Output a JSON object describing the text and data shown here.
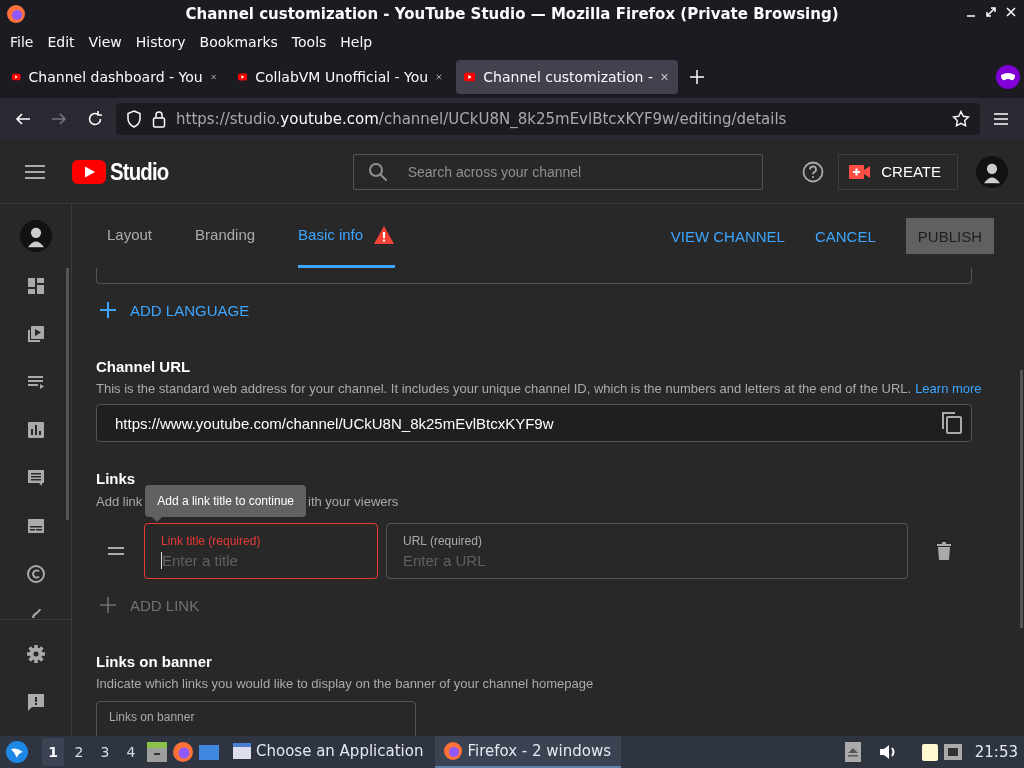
{
  "window": {
    "title": "Channel customization - YouTube Studio — Mozilla Firefox (Private Browsing)"
  },
  "menu": [
    "File",
    "Edit",
    "View",
    "History",
    "Bookmarks",
    "Tools",
    "Help"
  ],
  "browser_tabs": [
    {
      "label": "Channel dashboard - You",
      "selected": false
    },
    {
      "label": "CollabVM Unofficial - You",
      "selected": false
    },
    {
      "label": "Channel customization -",
      "selected": true
    }
  ],
  "address": {
    "prefix": "https://studio.",
    "domain": "youtube.com",
    "path": "/channel/UCkU8N_8k25mEvlBtcxKYF9w/editing/details"
  },
  "studio": {
    "logo": "Studio",
    "search_placeholder": "Search across your channel",
    "create": "CREATE"
  },
  "page_tabs": [
    {
      "label": "Layout",
      "selected": false,
      "warning": false
    },
    {
      "label": "Branding",
      "selected": false,
      "warning": false
    },
    {
      "label": "Basic info",
      "selected": true,
      "warning": true
    }
  ],
  "actions": [
    {
      "label": "VIEW CHANNEL",
      "disabled": false
    },
    {
      "label": "CANCEL",
      "disabled": false
    },
    {
      "label": "PUBLISH",
      "disabled": true
    }
  ],
  "add_language": "ADD LANGUAGE",
  "channel_url": {
    "heading": "Channel URL",
    "description": "This is the standard web address for your channel. It includes your unique channel ID, which is the numbers and letters at the end of the URL.",
    "link": "Learn more",
    "value": "https://www.youtube.com/channel/UCkU8N_8k25mEvlBtcxKYF9w"
  },
  "links": {
    "heading": "Links",
    "description_start": "Add link",
    "description_end": "ith your viewers",
    "tooltip": "Add a link title to continue",
    "fields": [
      {
        "label": "Link title (required)",
        "placeholder": "Enter a title",
        "error": true
      },
      {
        "label": "URL (required)",
        "placeholder": "Enter a URL",
        "error": false
      }
    ],
    "add_link": "ADD LINK"
  },
  "links_on_banner": {
    "heading": "Links on banner",
    "description": "Indicate which links you would like to display on the banner of your channel homepage",
    "select_label": "Links on banner"
  },
  "taskbar": {
    "workspaces": [
      {
        "label": "1",
        "selected": true
      },
      {
        "label": "2",
        "selected": false
      },
      {
        "label": "3",
        "selected": false
      },
      {
        "label": "4",
        "selected": false
      }
    ],
    "windows": [
      {
        "label": "Choose an Application",
        "selected": false
      },
      {
        "label": "Firefox - 2 windows",
        "selected": true
      }
    ],
    "clock": "21:53"
  }
}
